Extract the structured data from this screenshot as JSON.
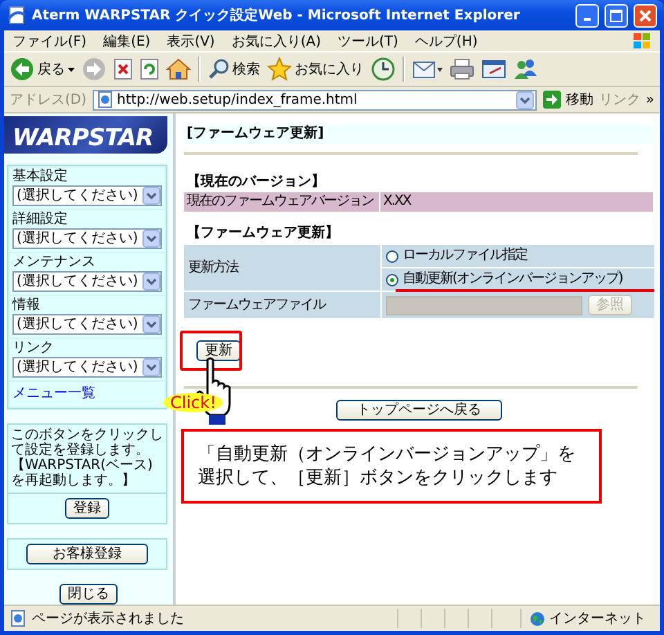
{
  "window": {
    "title": "Aterm WARPSTAR クイック設定Web - Microsoft Internet Explorer"
  },
  "menu_bar": [
    "ファイル(F)",
    "編集(E)",
    "表示(V)",
    "お気に入り(A)",
    "ツール(T)",
    "ヘルプ(H)"
  ],
  "toolbar": [
    {
      "kind": "back",
      "label": "戻る"
    },
    {
      "kind": "forward"
    },
    {
      "kind": "stop"
    },
    {
      "kind": "refresh"
    },
    {
      "kind": "home"
    },
    {
      "kind": "separator"
    },
    {
      "kind": "search",
      "label": "検索"
    },
    {
      "kind": "favorites",
      "label": "お気に入り"
    },
    {
      "kind": "history"
    },
    {
      "kind": "separator"
    },
    {
      "kind": "mail"
    },
    {
      "kind": "print"
    },
    {
      "kind": "edit"
    },
    {
      "kind": "messenger"
    }
  ],
  "address_bar": {
    "label": "アドレス(D)",
    "url": "http://web.setup/index_frame.html",
    "go": "移動",
    "links": "リンク",
    "more": "»"
  },
  "sidebar": {
    "logo": "WARPSTAR",
    "menus": [
      {
        "label": "基本設定",
        "value": "(選択してください)"
      },
      {
        "label": "詳細設定",
        "value": "(選択してください)"
      },
      {
        "label": "メンテナンス",
        "value": "(選択してください)"
      },
      {
        "label": "情報",
        "value": "(選択してください)"
      },
      {
        "label": "リンク",
        "value": "(選択してください)"
      }
    ],
    "menu_list_link": "メニュー一覧",
    "note": "このボタンをクリックして設定を登録します。【WARPSTAR(ベース)を再起動します。】",
    "register_button": "登録",
    "customer_button": "お客様登録",
    "close_button": "閉じる"
  },
  "main": {
    "page_title": "[ファームウェア更新]",
    "version_section": {
      "heading": "【現在のバージョン】",
      "label": "現在のファームウェアバージョン",
      "value": "X.XX"
    },
    "update_section": {
      "heading": "【ファームウェア更新】",
      "method_label": "更新方法",
      "options": [
        {
          "label": "ローカルファイル指定",
          "selected": false
        },
        {
          "label": "自動更新(オンラインバージョンアップ)",
          "selected": true
        }
      ],
      "file_label": "ファームウェアファイル",
      "file_field": {
        "disabled": true
      },
      "browse_button": {
        "label": "参照",
        "disabled": true
      }
    },
    "update_button": "更新",
    "top_button": "トップページへ戻る"
  },
  "annotation": {
    "click_label": "Click!",
    "callout": "「自動更新（オンラインバージョンアップ」を選択して、［更新］ボタンをクリックします"
  },
  "status_bar": {
    "text": "ページが表示されました",
    "zone": "インターネット"
  }
}
